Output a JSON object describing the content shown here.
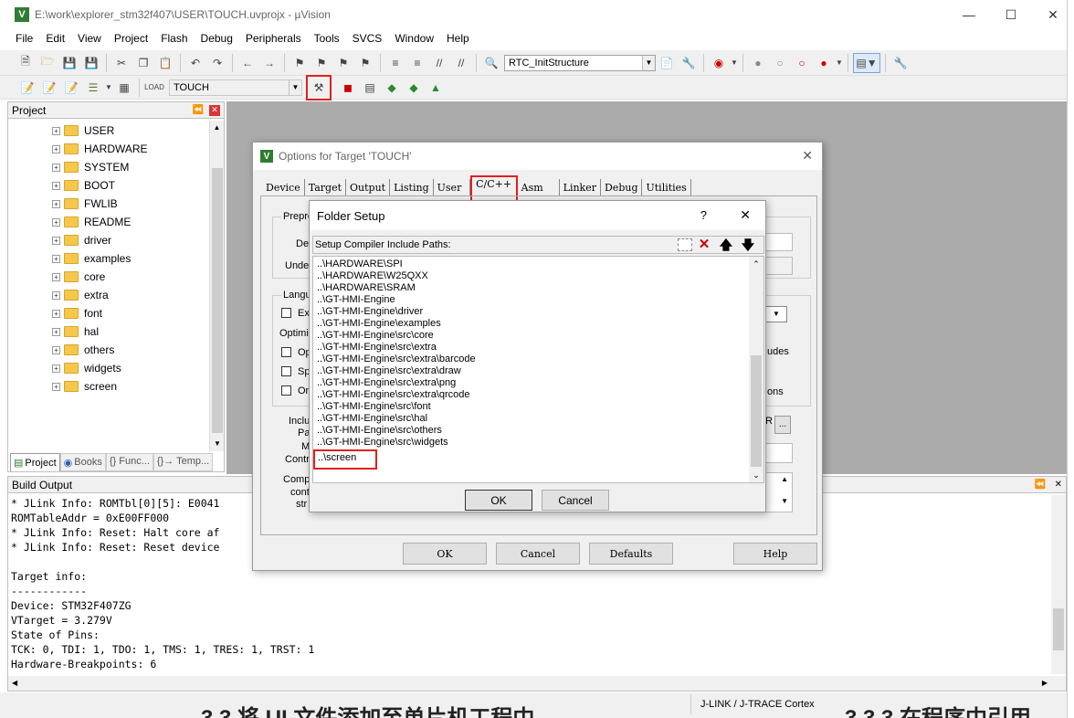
{
  "window": {
    "title": "E:\\work\\explorer_stm32f407\\USER\\TOUCH.uvprojx - µVision",
    "icon": "V"
  },
  "menu": [
    "File",
    "Edit",
    "View",
    "Project",
    "Flash",
    "Debug",
    "Peripherals",
    "Tools",
    "SVCS",
    "Window",
    "Help"
  ],
  "toolbar": {
    "function_dropdown": "RTC_InitStructure",
    "target_dropdown": "TOUCH"
  },
  "project": {
    "title": "Project",
    "items": [
      "USER",
      "HARDWARE",
      "SYSTEM",
      "BOOT",
      "FWLIB",
      "README",
      "driver",
      "examples",
      "core",
      "extra",
      "font",
      "hal",
      "others",
      "widgets",
      "screen"
    ],
    "tabs": [
      "Project",
      "Books",
      "{} Func...",
      "{}→ Temp..."
    ]
  },
  "build": {
    "title": "Build Output",
    "lines": [
      "* JLink Info: ROMTbl[0][5]: E0041",
      "ROMTableAddr = 0xE00FF000",
      "* JLink Info: Reset: Halt core af",
      "* JLink Info: Reset: Reset device",
      "",
      "Target info:",
      "------------",
      "Device: STM32F407ZG",
      "VTarget = 3.279V",
      "State of Pins:",
      "TCK: 0, TDI: 1, TDO: 1, TMS: 1, TRES: 1, TRST: 1",
      "Hardware-Breakpoints: 6"
    ]
  },
  "status": {
    "debugger": "J-LINK / J-TRACE Cortex",
    "bg_text_left": "3.3 将 UI 文件添加至单片机工程中",
    "bg_text_right": "3.3.3 在程序中引用"
  },
  "options": {
    "title": "Options for Target 'TOUCH'",
    "tabs": [
      "Device",
      "Target",
      "Output",
      "Listing",
      "User",
      "C/C++",
      "Asm",
      "Linker",
      "Debug",
      "Utilities"
    ],
    "partial_labels": {
      "preproc": "Prepro",
      "define": "De",
      "undefine": "Unde",
      "language": "Langu",
      "ex": "Ex",
      "optim": "Optimi",
      "op": "Op",
      "sp": "Sp",
      "on": "On",
      "include": "Inclu",
      "paths": "Pat",
      "misc": "M",
      "control": "Contr",
      "compiler": "Comp",
      "contr2": "cont",
      "str": "str",
      "udes": "udes",
      "ons": "ons",
      "r": "R"
    },
    "buttons": {
      "ok": "OK",
      "cancel": "Cancel",
      "defaults": "Defaults",
      "help": "Help"
    }
  },
  "folder": {
    "title": "Folder Setup",
    "help": "?",
    "close": "✕",
    "label": "Setup Compiler Include Paths:",
    "paths": [
      "..\\HARDWARE\\SPI",
      "..\\HARDWARE\\W25QXX",
      "..\\HARDWARE\\SRAM",
      "..\\GT-HMI-Engine",
      "..\\GT-HMI-Engine\\driver",
      "..\\GT-HMI-Engine\\examples",
      "..\\GT-HMI-Engine\\src\\core",
      "..\\GT-HMI-Engine\\src\\extra",
      "..\\GT-HMI-Engine\\src\\extra\\barcode",
      "..\\GT-HMI-Engine\\src\\extra\\draw",
      "..\\GT-HMI-Engine\\src\\extra\\png",
      "..\\GT-HMI-Engine\\src\\extra\\qrcode",
      "..\\GT-HMI-Engine\\src\\font",
      "..\\GT-HMI-Engine\\src\\hal",
      "..\\GT-HMI-Engine\\src\\others",
      "..\\GT-HMI-Engine\\src\\widgets",
      "..\\screen"
    ],
    "ok": "OK",
    "cancel": "Cancel"
  },
  "colors": {
    "highlight": "#e02020",
    "folder": "#f5c84c",
    "workspace": "#ababab"
  }
}
